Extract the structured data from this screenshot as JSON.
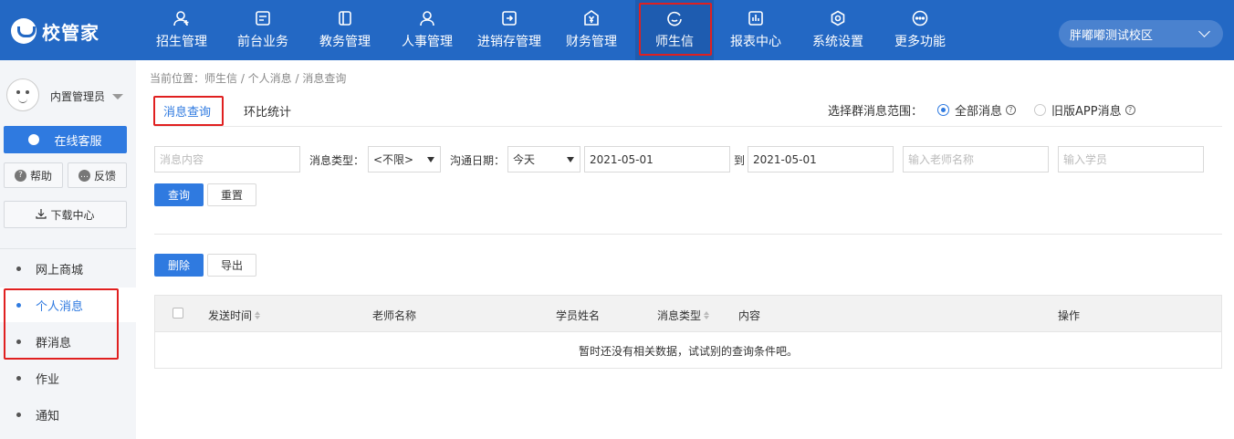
{
  "app": {
    "logo_text": "校管家",
    "campus": "胖嘟嘟测试校区"
  },
  "nav": [
    {
      "label": "招生管理",
      "icon": "user-add-icon"
    },
    {
      "label": "前台业务",
      "icon": "desk-icon"
    },
    {
      "label": "教务管理",
      "icon": "book-icon"
    },
    {
      "label": "人事管理",
      "icon": "person-icon"
    },
    {
      "label": "进销存管理",
      "icon": "inventory-icon"
    },
    {
      "label": "财务管理",
      "icon": "yuan-icon"
    },
    {
      "label": "师生信",
      "icon": "chat-icon"
    },
    {
      "label": "报表中心",
      "icon": "report-icon"
    },
    {
      "label": "系统设置",
      "icon": "gear-icon"
    },
    {
      "label": "更多功能",
      "icon": "more-icon"
    }
  ],
  "sidebar": {
    "admin_name": "内置管理员",
    "service_label": "在线客服",
    "help_label": "帮助",
    "feedback_label": "反馈",
    "download_label": "下载中心",
    "items": [
      {
        "label": "网上商城"
      },
      {
        "label": "个人消息"
      },
      {
        "label": "群消息"
      },
      {
        "label": "作业"
      },
      {
        "label": "通知"
      }
    ]
  },
  "breadcrumb": "当前位置：师生信 / 个人消息 / 消息查询",
  "tabs": [
    {
      "label": "消息查询"
    },
    {
      "label": "环比统计"
    }
  ],
  "scope": {
    "label": "选择群消息范围：",
    "options": [
      {
        "label": "全部消息",
        "selected": true
      },
      {
        "label": "旧版APP消息",
        "selected": false
      }
    ]
  },
  "filters": {
    "content_placeholder": "消息内容",
    "type_label": "消息类型：",
    "type_value": "<不限>",
    "date_label": "沟通日期：",
    "date_range_value": "今天",
    "date_from": "2021-05-01",
    "to_label": "到",
    "date_to": "2021-05-01",
    "teacher_placeholder": "输入老师名称",
    "student_placeholder": "输入学员",
    "search_label": "查询",
    "reset_label": "重置"
  },
  "actions": {
    "delete_label": "删除",
    "export_label": "导出"
  },
  "table": {
    "columns": [
      "发送时间",
      "老师名称",
      "学员姓名",
      "消息类型",
      "内容",
      "操作"
    ],
    "empty_text": "暂时还没有相关数据，试试别的查询条件吧。"
  },
  "colors": {
    "brand": "#2368c4",
    "primary": "#2f7ae0",
    "highlight": "#e02020"
  }
}
